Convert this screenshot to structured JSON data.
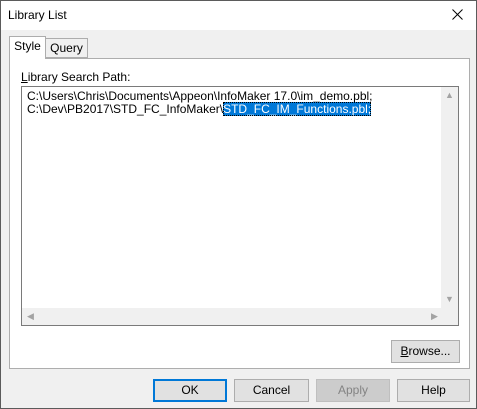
{
  "window": {
    "title": "Library List"
  },
  "tabs": [
    {
      "label": "Style",
      "active": true
    },
    {
      "label": "Query",
      "active": false
    }
  ],
  "search_path": {
    "label_underlined": "L",
    "label_rest": "ibrary Search Path:",
    "lines": [
      "C:\\Users\\Chris\\Documents\\Appeon\\InfoMaker 17.0\\im_demo.pbl;",
      "C:\\Dev\\PB2017\\STD_FC_InfoMaker\\"
    ],
    "selected_text": "STD_FC_IM_Functions.pbl;"
  },
  "buttons": {
    "browse_underlined": "B",
    "browse_rest": "rowse...",
    "ok": "OK",
    "cancel": "Cancel",
    "apply": "Apply",
    "help": "Help"
  },
  "icons": {
    "close": "close-icon",
    "scroll_up": "arrow-up-icon",
    "scroll_down": "arrow-down-icon",
    "scroll_left": "arrow-left-icon",
    "scroll_right": "arrow-right-icon"
  },
  "colors": {
    "selection": "#0078d7",
    "default_button_border": "#0078d7",
    "disabled_text": "#838383"
  }
}
